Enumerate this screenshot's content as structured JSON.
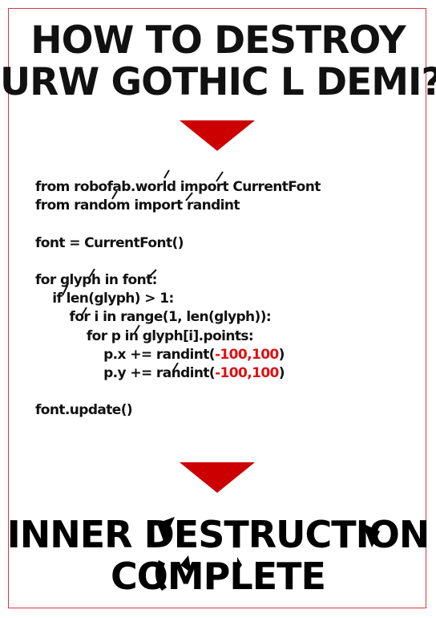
{
  "title": {
    "line1": "HOW  TO DESTROY",
    "line2": "URW GOTHIC L DEMI?"
  },
  "arrow_color": "#cc0000",
  "frame_color": "#d9363e",
  "code": {
    "lines": [
      {
        "text": "from robofab.world import CurrentFont"
      },
      {
        "text": "from random import randint"
      },
      {
        "text": ""
      },
      {
        "text": "font = CurrentFont()"
      },
      {
        "text": ""
      },
      {
        "text": "for glyph in font:"
      },
      {
        "text": "    if len(glyph) > 1:"
      },
      {
        "text": "        for i in range(1, len(glyph)):"
      },
      {
        "text": "            for p in glyph[i].points:"
      },
      {
        "prefix": "                p.x += randint(",
        "num": "-100,100",
        "suffix": ")"
      },
      {
        "prefix": "                p.y += randint(",
        "num": "-100,100",
        "suffix": ")"
      },
      {
        "text": ""
      },
      {
        "text": "font.update()"
      }
    ]
  },
  "result": {
    "line1": "INNER  DESTRUCTION",
    "line2": "COMPLETE"
  }
}
